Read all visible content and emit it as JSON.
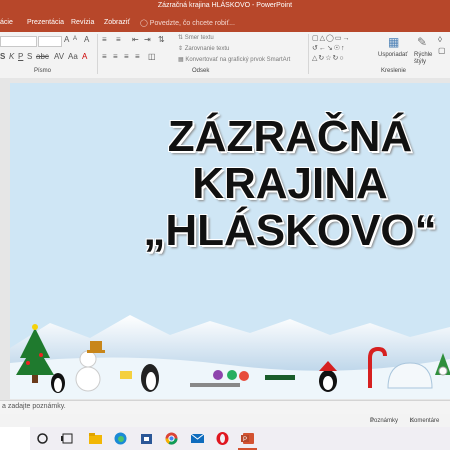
{
  "window": {
    "title": "Zázračná krajina HLÁSKOVO - PowerPoint"
  },
  "ribbon_tabs": [
    "ácie",
    "Prezentácia",
    "Revízia",
    "Zobraziť"
  ],
  "tell_me": "Povedzte, čo chcete robiť...",
  "ribbon": {
    "text_direction": "Smer textu",
    "align_text": "Zarovnanie textu",
    "convert_smartart": "Konvertovať na grafický prvok SmartArt",
    "arrange": "Usporiadať",
    "quick_styles": "Rýchle štýly",
    "groups": {
      "font": "Písmo",
      "paragraph": "Odsek",
      "drawing": "Kreslenie"
    }
  },
  "slide": {
    "title_lines": [
      "ZÁZRAČNÁ",
      "KRAJINA",
      "„HLÁSKOVO“"
    ]
  },
  "notes_placeholder": "a zadajte poznámky.",
  "status": {
    "notes": "Poznámky",
    "comments": "Komentáre"
  },
  "taskbar": {
    "icons": [
      "search-circle-icon",
      "task-view-icon",
      "file-explorer-icon",
      "edge-icon",
      "store-icon",
      "chrome-icon",
      "mail-icon",
      "opera-icon",
      "powerpoint-icon"
    ]
  },
  "colors": {
    "accent": "#b7472a",
    "slide_bg": "#cfe6f5"
  }
}
